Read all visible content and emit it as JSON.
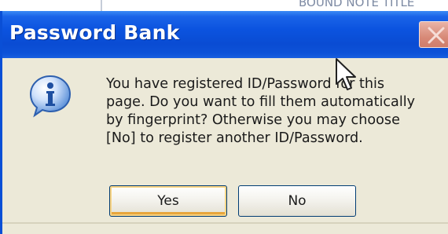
{
  "background_page": {
    "partial_text": "BOUND NOTE TITLE"
  },
  "dialog": {
    "title": "Password Bank",
    "icon": "info-icon",
    "message": "You have registered ID/Password for this\npage. Do you want to fill them automatically\nby fingerprint? Otherwise you may choose\n[No] to register another ID/Password.",
    "buttons": {
      "yes_label": "Yes",
      "no_label": "No"
    },
    "close_icon": "close-icon"
  },
  "colors": {
    "titlebar": "#0a4cd3",
    "dialog_bg": "#ece9d8",
    "title_text": "#ffffff",
    "close_button": "#d88a78",
    "default_button_highlight": "#f9d483"
  }
}
